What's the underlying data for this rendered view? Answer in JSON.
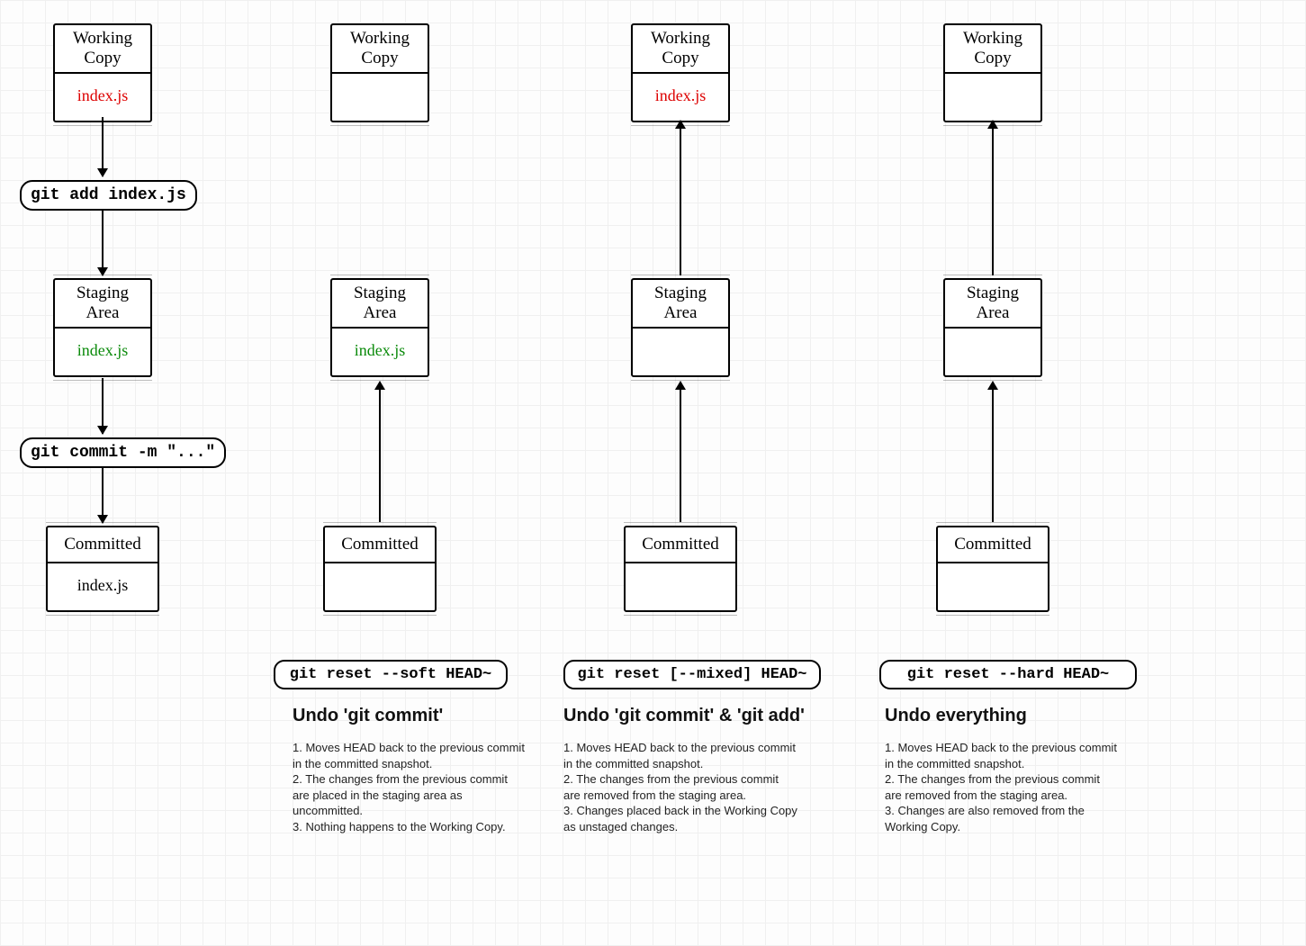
{
  "labels": {
    "working_copy": "Working\nCopy",
    "staging_area": "Staging\nArea",
    "committed": "Committed",
    "file": "index.js"
  },
  "commands": {
    "git_add": "git add index.js",
    "git_commit": "git commit -m \"...\"",
    "reset_soft": "git reset --soft HEAD~",
    "reset_mixed": "git reset [--mixed] HEAD~",
    "reset_hard": "git reset --hard HEAD~"
  },
  "captions": {
    "soft": {
      "heading": "Undo 'git commit'",
      "body": "1. Moves HEAD back to the previous commit in the committed snapshot.\n2. The changes from the previous commit are placed in the staging area as uncommitted.\n3. Nothing happens to the Working Copy."
    },
    "mixed": {
      "heading": "Undo 'git commit' & 'git add'",
      "body": "1. Moves HEAD back to the previous commit in the committed snapshot.\n2. The changes from the previous commit are removed from the staging area.\n3. Changes placed back in the Working Copy as unstaged changes."
    },
    "hard": {
      "heading": "Undo everything",
      "body": "1. Moves HEAD back to the previous commit in the committed snapshot.\n2. The changes from the previous commit are removed from the staging area.\n3. Changes are also removed from the Working Copy."
    }
  }
}
